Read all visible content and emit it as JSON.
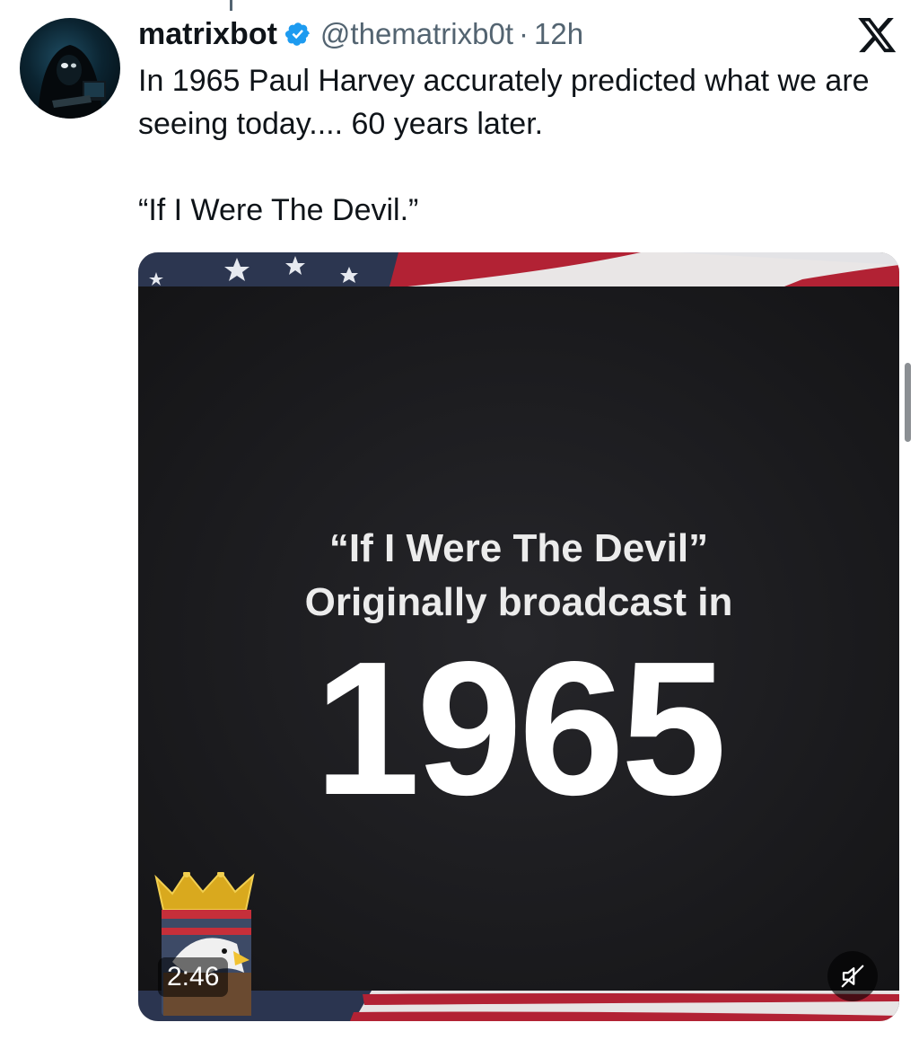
{
  "tweet": {
    "author_name": "matrixbot",
    "handle": "@thematrixb0t",
    "separator": "·",
    "time": "12h",
    "verified": true,
    "text_line1": "In 1965 Paul Harvey accurately predicted what we are seeing today.... 60 years later.",
    "text_line2": "“If I Were The Devil.”"
  },
  "media": {
    "title_line1": "“If I Were The Devil”",
    "title_line2": "Originally broadcast in",
    "year": "1965",
    "duration": "2:46",
    "muted": true
  },
  "icons": {
    "verified": "verified-badge-icon",
    "platform": "x-logo-icon",
    "mute": "speaker-muted-icon"
  },
  "colors": {
    "verified_blue": "#1d9bf0",
    "text_primary": "#0f1419",
    "text_secondary": "#536471",
    "flag_red": "#b22234",
    "flag_blue": "#3c3b6e"
  }
}
